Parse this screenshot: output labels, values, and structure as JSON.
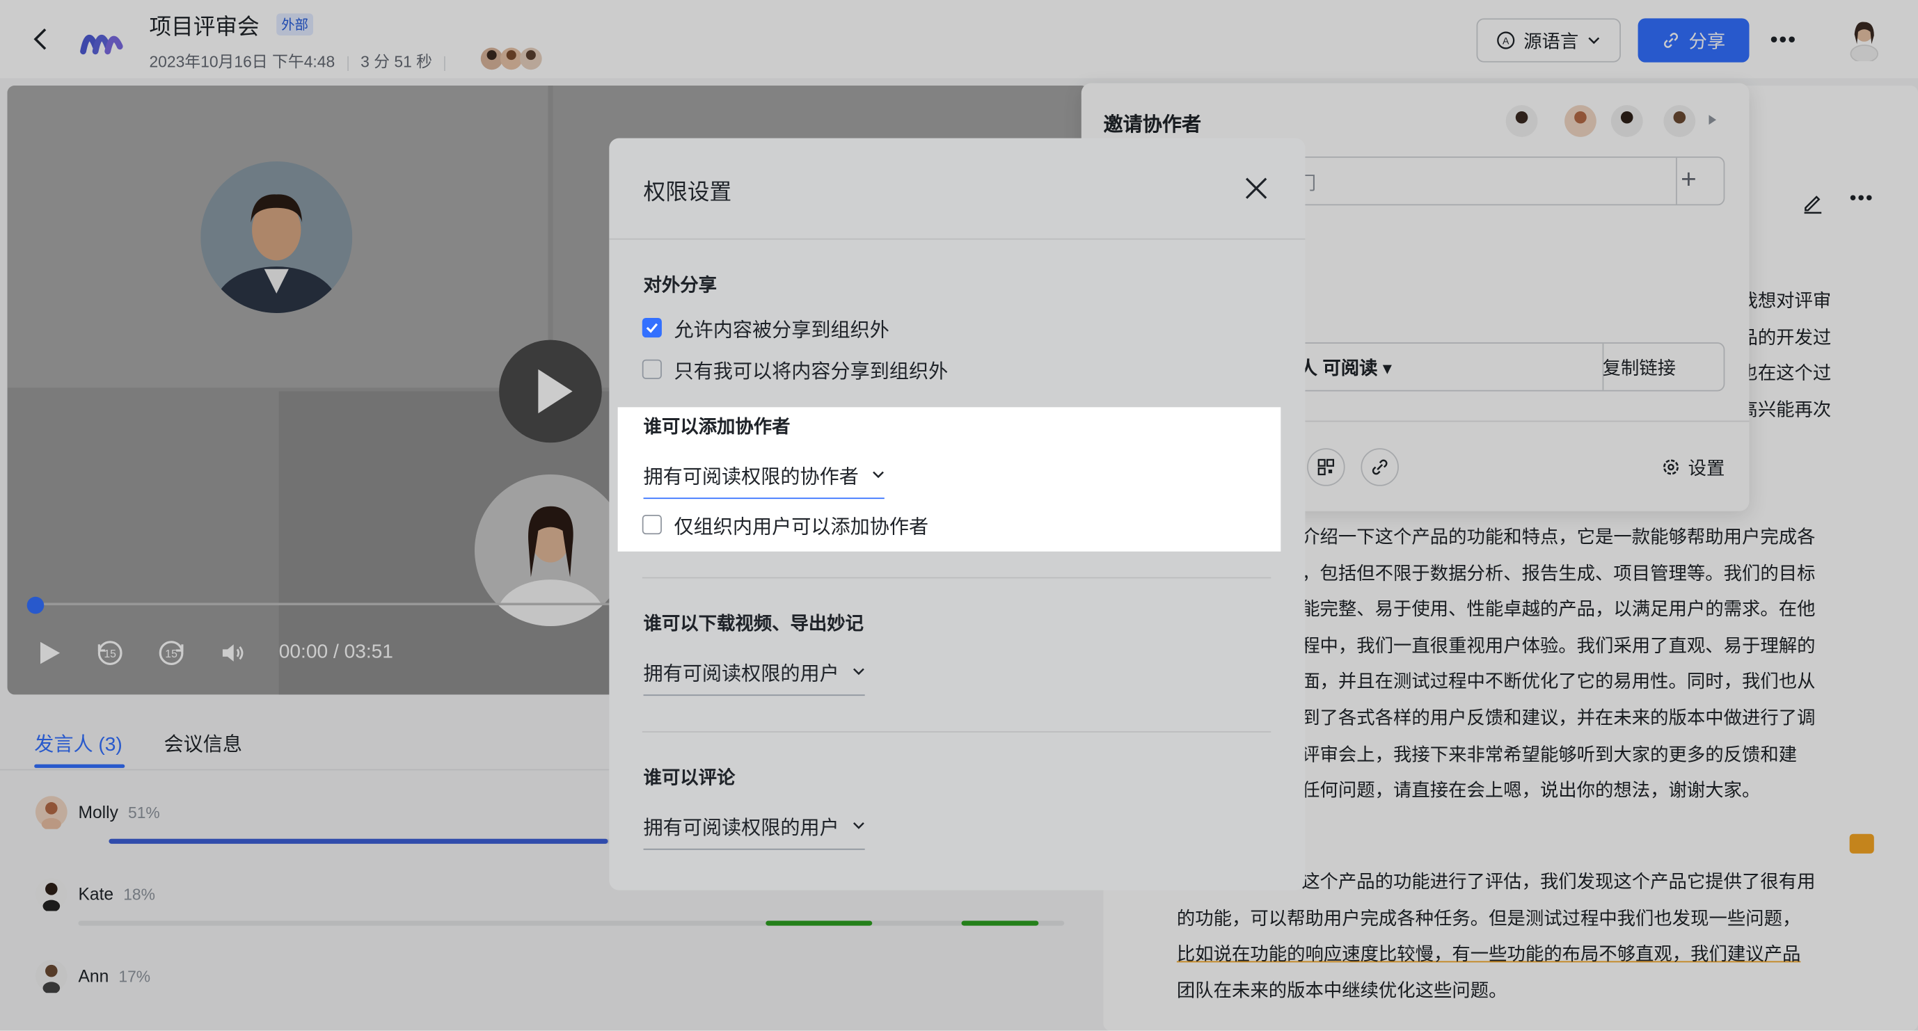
{
  "header": {
    "title": "项目评审会",
    "tag": "外部",
    "datetime": "2023年10月16日 下午4:48",
    "duration": "3 分 51 秒",
    "lang_button": "源语言",
    "share_button": "分享"
  },
  "player": {
    "time": "00:00 / 03:51",
    "accent": "#3370ff"
  },
  "tabs": [
    {
      "label": "发言人 (3)"
    },
    {
      "label": "会议信息"
    }
  ],
  "speakers": [
    {
      "name": "Molly",
      "pct": "51%",
      "share": 0.51
    },
    {
      "name": "Kate",
      "pct": "18%",
      "share": 0.18
    },
    {
      "name": "Ann",
      "pct": "17%",
      "share": 0.17
    }
  ],
  "share_popover": {
    "title": "邀请协作者",
    "input_fragment": "门",
    "readable": "人 可阅读",
    "copy_link": "复制链接",
    "settings": "设置"
  },
  "doc_right_lines": [
    "我想对评审",
    "品的开发过",
    "也在这个过",
    "高兴能再次"
  ],
  "doc_lines": [
    "介绍一下这个产品的功能和特点，它是一款能够帮助用户完成各",
    "，包括但不限于数据分析、报告生成、项目管理等。我们的目标",
    "能完整、易于使用、性能卓越的产品，以满足用户的需求。在他",
    "程中，我们一直很重视用户体验。我们采用了直观、易于理解的",
    "面，并且在测试过程中不断优化了它的易用性。同时，我们也从",
    "到了各式各样的用户反馈和建议，并在未来的版本中做进行了调",
    "评审会上，我接下来非常希望能够听到大家的更多的反馈和建",
    "任何问题，请直接在会上嗯，说出你的想法，谢谢大家。"
  ],
  "doc_lines2": [
    "这个产品的功能进行了评估，我们发现这个产品它提供了很有用",
    "的功能，可以帮助用户完成各种任务。但是测试过程中我们也发现一些问题，",
    "比如说在功能的响应速度比较慢，有一些功能的布局不够直观，我们建议产品",
    "团队在未来的版本中继续优化这些问题。"
  ],
  "modal": {
    "title": "权限设置",
    "sections": {
      "external": {
        "title": "对外分享",
        "option1": "允许内容被分享到组织外",
        "option1_checked": true,
        "option2": "只有我可以将内容分享到组织外",
        "option2_checked": false
      },
      "add_collab": {
        "title": "谁可以添加协作者",
        "select": "拥有可阅读权限的协作者",
        "option": "仅组织内用户可以添加协作者",
        "option_checked": false
      },
      "download": {
        "title": "谁可以下载视频、导出妙记",
        "select": "拥有可阅读权限的用户"
      },
      "comment": {
        "title": "谁可以评论",
        "select": "拥有可阅读权限的用户"
      }
    }
  }
}
